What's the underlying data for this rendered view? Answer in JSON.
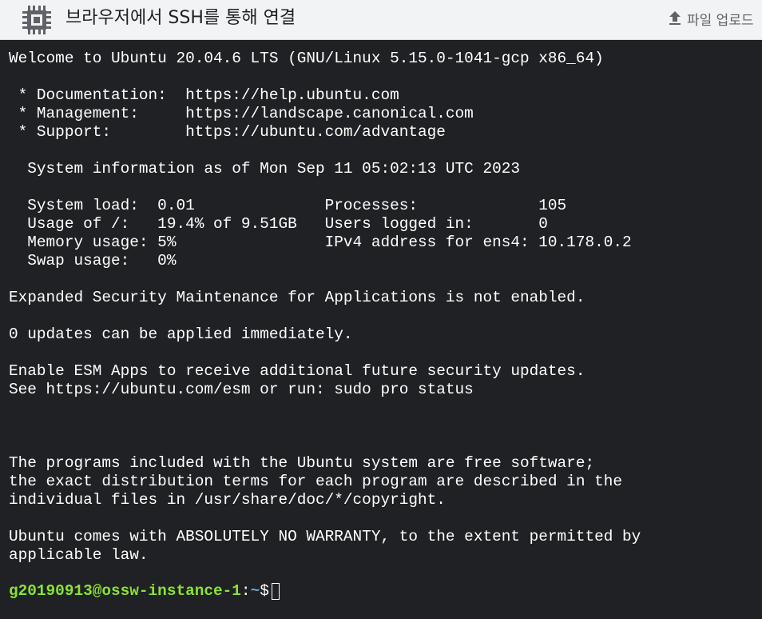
{
  "header": {
    "title": "브라우저에서 SSH를 통해 연결",
    "upload_label": "파일 업로드",
    "chip_icon": "chip-icon",
    "upload_icon": "upload-arrow-icon"
  },
  "terminal": {
    "output": "Welcome to Ubuntu 20.04.6 LTS (GNU/Linux 5.15.0-1041-gcp x86_64)\n\n * Documentation:  https://help.ubuntu.com\n * Management:     https://landscape.canonical.com\n * Support:        https://ubuntu.com/advantage\n\n  System information as of Mon Sep 11 05:02:13 UTC 2023\n\n  System load:  0.01              Processes:             105\n  Usage of /:   19.4% of 9.51GB   Users logged in:       0\n  Memory usage: 5%                IPv4 address for ens4: 10.178.0.2\n  Swap usage:   0%\n\nExpanded Security Maintenance for Applications is not enabled.\n\n0 updates can be applied immediately.\n\nEnable ESM Apps to receive additional future security updates.\nSee https://ubuntu.com/esm or run: sudo pro status\n\n\n\nThe programs included with the Ubuntu system are free software;\nthe exact distribution terms for each program are described in the\nindividual files in /usr/share/doc/*/copyright.\n\nUbuntu comes with ABSOLUTELY NO WARRANTY, to the extent permitted by\napplicable law.",
    "prompt": {
      "user_host": "g20190913@ossw-instance-1",
      "separator": ":",
      "path": "~",
      "symbol": "$"
    },
    "colors": {
      "background": "#202124",
      "text": "#ffffff",
      "prompt_user": "#8ae234",
      "prompt_path": "#729fcf"
    }
  }
}
